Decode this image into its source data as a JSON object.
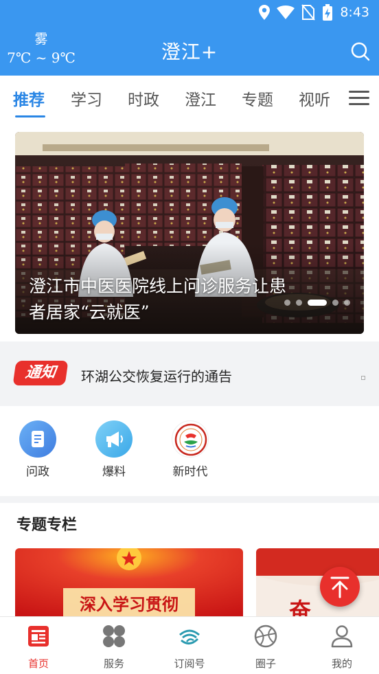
{
  "status_bar": {
    "time": "8:43"
  },
  "header": {
    "weather_condition": "雾",
    "weather_temp": "7℃ ~ 9℃",
    "title": "澄江+"
  },
  "tabs": [
    {
      "label": "推荐",
      "active": true
    },
    {
      "label": "学习"
    },
    {
      "label": "时政"
    },
    {
      "label": "澄江"
    },
    {
      "label": "专题"
    },
    {
      "label": "视听"
    }
  ],
  "banner": {
    "title": "澄江市中医医院线上问诊服务让患者居家“云就医”",
    "slide_count": 5,
    "active_slide": 3
  },
  "notice": {
    "badge": "通知",
    "text": "环湖公交恢复运行的通告"
  },
  "quick_links": [
    {
      "label": "问政",
      "icon": "document-icon"
    },
    {
      "label": "爆料",
      "icon": "megaphone-icon"
    },
    {
      "label": "新时代",
      "icon": "new-era-logo"
    }
  ],
  "section": {
    "title": "专题专栏"
  },
  "topic_cards": [
    {
      "text": "深入学习贯彻"
    },
    {
      "text": "奋"
    }
  ],
  "bottom_nav": [
    {
      "label": "首页",
      "icon": "news-icon",
      "active": true
    },
    {
      "label": "服务",
      "icon": "grid-clover-icon"
    },
    {
      "label": "订阅号",
      "icon": "subscription-icon"
    },
    {
      "label": "圈子",
      "icon": "circle-icon"
    },
    {
      "label": "我的",
      "icon": "person-icon"
    }
  ],
  "colors": {
    "primary_blue": "#3a97f0",
    "accent_red": "#e8302c",
    "tab_active": "#2a86e5"
  }
}
